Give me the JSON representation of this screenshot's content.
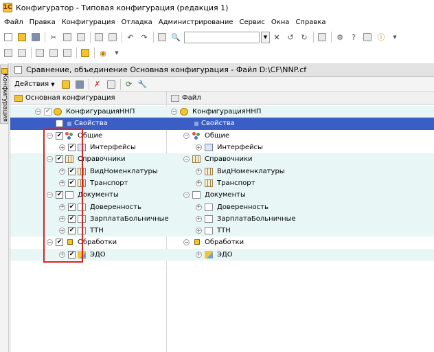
{
  "app": {
    "title": "Конфигуратор - Типовая конфигурация (редакция 1)",
    "icon": "1c-app-icon"
  },
  "menu": [
    "Файл",
    "Правка",
    "Конфигурация",
    "Отладка",
    "Администрирование",
    "Сервис",
    "Окна",
    "Справка"
  ],
  "side_tab": {
    "label": "Конфигурация"
  },
  "window": {
    "title": "Сравнение, объединение Основная конфигурация - Файл D:\\CF\\NNP.cf",
    "actions_label": "Действия"
  },
  "columns": {
    "left": "Основная конфигурация",
    "right": "Файл"
  },
  "tree": [
    {
      "level": 0,
      "label": "КонфигурацияННП",
      "icon": "configuration-icon",
      "expander": "minus",
      "checked": true,
      "dim": true,
      "tinted": true,
      "selected": false
    },
    {
      "level": 1,
      "label": "Свойства",
      "icon": "properties-icon",
      "expander": "none",
      "checked": false,
      "dim": false,
      "tinted": false,
      "selected": true
    },
    {
      "level": 1,
      "label": "Общие",
      "icon": "common-icon",
      "expander": "minus",
      "checked": true,
      "dim": false,
      "tinted": false,
      "selected": false
    },
    {
      "level": 2,
      "label": "Интерфейсы",
      "icon": "interfaces-icon",
      "expander": "plus",
      "checked": true,
      "dim": false,
      "tinted": false,
      "selected": false
    },
    {
      "level": 1,
      "label": "Справочники",
      "icon": "catalogs-icon",
      "expander": "minus",
      "checked": true,
      "dim": false,
      "tinted": true,
      "selected": false
    },
    {
      "level": 2,
      "label": "ВидНоменклатуры",
      "icon": "catalog-icon",
      "expander": "plus",
      "checked": true,
      "dim": false,
      "tinted": true,
      "selected": false
    },
    {
      "level": 2,
      "label": "Транспорт",
      "icon": "catalog-icon",
      "expander": "plus",
      "checked": true,
      "dim": false,
      "tinted": true,
      "selected": false
    },
    {
      "level": 1,
      "label": "Документы",
      "icon": "documents-icon",
      "expander": "minus",
      "checked": true,
      "dim": false,
      "tinted": true,
      "selected": false
    },
    {
      "level": 2,
      "label": "Доверенность",
      "icon": "document-icon",
      "expander": "plus",
      "checked": true,
      "dim": false,
      "tinted": true,
      "selected": false
    },
    {
      "level": 2,
      "label": "ЗарплатаБольничные",
      "icon": "document-icon",
      "expander": "plus",
      "checked": true,
      "dim": false,
      "tinted": true,
      "selected": false
    },
    {
      "level": 2,
      "label": "ТТН",
      "icon": "document-icon",
      "expander": "plus",
      "checked": true,
      "dim": false,
      "tinted": true,
      "selected": false
    },
    {
      "level": 1,
      "label": "Обработки",
      "icon": "processing-icon",
      "expander": "minus",
      "checked": true,
      "dim": false,
      "tinted": false,
      "selected": false
    },
    {
      "level": 2,
      "label": "ЭДО",
      "icon": "edo-icon",
      "expander": "plus",
      "checked": true,
      "dim": false,
      "tinted": true,
      "selected": false
    }
  ],
  "highlight": {
    "color": "#e01f1f"
  },
  "colors": {
    "selection": "#3b5ec6",
    "tint": "#e8f6f6",
    "header": "#e3e3e3"
  }
}
